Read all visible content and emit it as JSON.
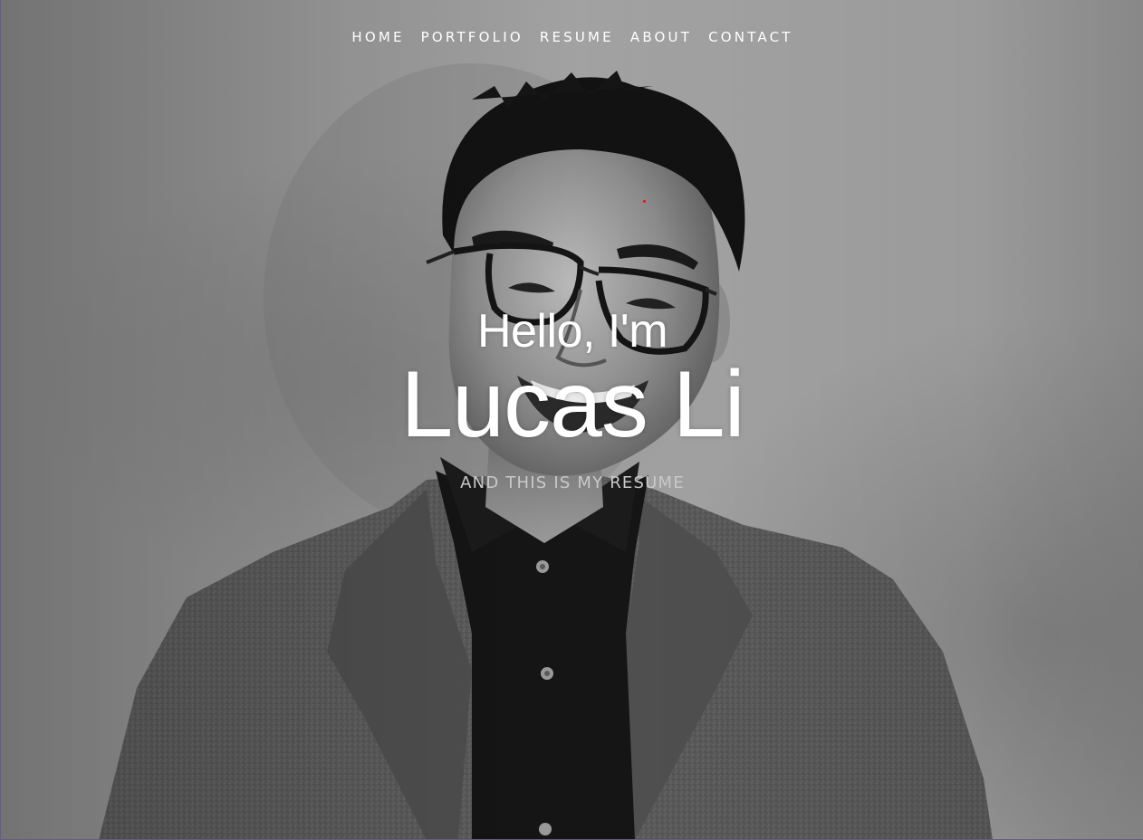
{
  "nav": {
    "items": [
      {
        "label": "HOME"
      },
      {
        "label": "PORTFOLIO"
      },
      {
        "label": "RESUME"
      },
      {
        "label": "ABOUT"
      },
      {
        "label": "CONTACT"
      }
    ]
  },
  "hero": {
    "greeting": "Hello, I'm",
    "name": "Lucas Li",
    "tagline": "AND THIS IS MY RESUME"
  },
  "colors": {
    "text": "#ffffff",
    "tagline": "#c9c9c9",
    "background": "#9a9a9a",
    "accent_dot": "#ee1111"
  },
  "icons": [
    "portrait-photo"
  ]
}
